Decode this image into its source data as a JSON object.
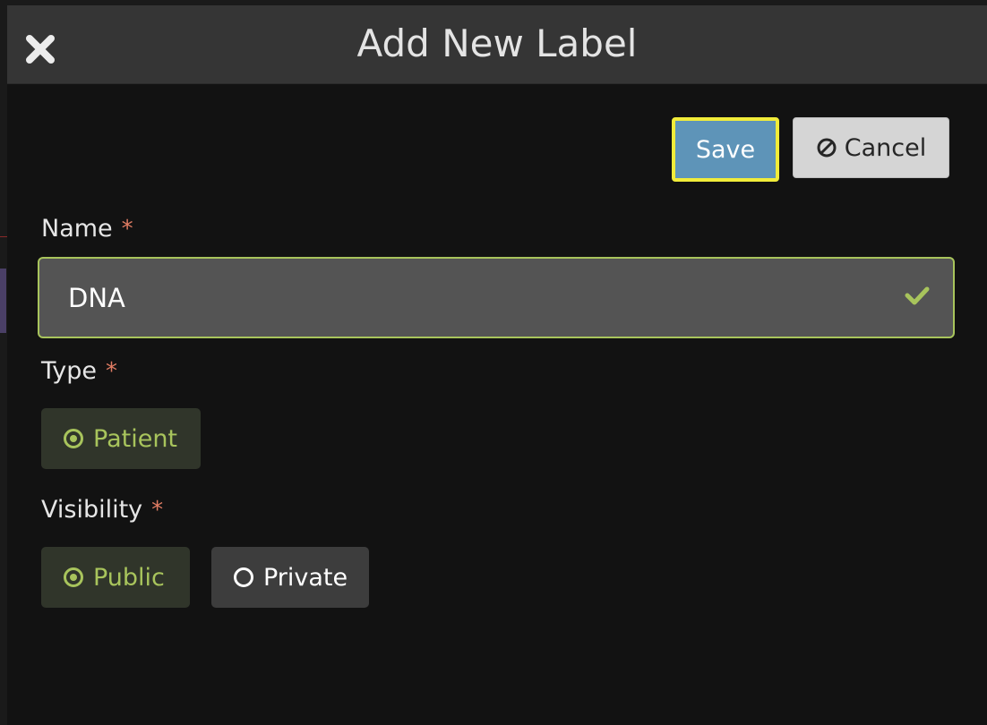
{
  "dialog": {
    "title": "Add New Label"
  },
  "actions": {
    "save_label": "Save",
    "cancel_label": "Cancel"
  },
  "fields": {
    "name": {
      "label": "Name",
      "required_marker": "*",
      "value": "DNA",
      "valid": true
    },
    "type": {
      "label": "Type",
      "required_marker": "*",
      "options": [
        {
          "label": "Patient",
          "selected": true
        }
      ]
    },
    "visibility": {
      "label": "Visibility",
      "required_marker": "*",
      "options": [
        {
          "label": "Public",
          "selected": true
        },
        {
          "label": "Private",
          "selected": false
        }
      ]
    }
  },
  "icons": {
    "close": "close-icon",
    "cancel": "ban-icon",
    "valid": "check-icon",
    "radio_on": "radio-checked-icon",
    "radio_off": "radio-unchecked-icon"
  },
  "colors": {
    "header_bg": "#353535",
    "dialog_bg": "#121212",
    "save_bg": "#5e94b8",
    "save_focus_ring": "#f1ec3a",
    "cancel_bg": "#d5d5d5",
    "input_bg": "#545454",
    "valid_accent": "#a8c45c",
    "required_marker": "#e07c63",
    "radio_selected_bg": "#30352a",
    "radio_unselected_bg": "#3d3d3d"
  }
}
